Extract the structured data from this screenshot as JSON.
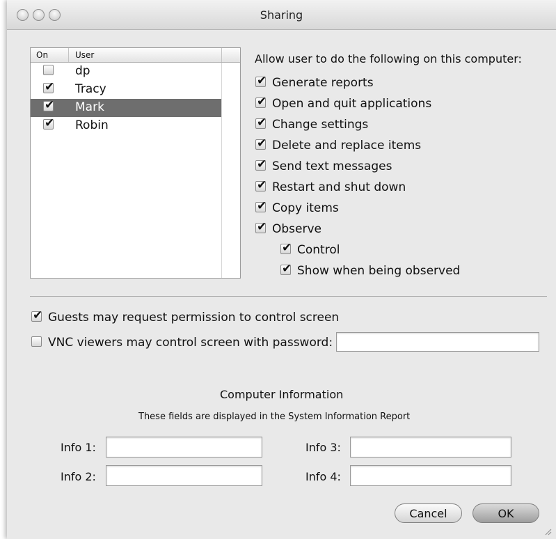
{
  "window": {
    "title": "Sharing"
  },
  "user_list": {
    "columns": {
      "on": "On",
      "user": "User"
    },
    "users": [
      {
        "name": "dp",
        "checked": false
      },
      {
        "name": "Tracy",
        "checked": true
      },
      {
        "name": "Mark",
        "checked": true,
        "selected": true
      },
      {
        "name": "Robin",
        "checked": true
      }
    ]
  },
  "permissions": {
    "heading": "Allow user to do the following on this computer:",
    "items": [
      {
        "label": "Generate reports",
        "checked": true
      },
      {
        "label": "Open and quit applications",
        "checked": true
      },
      {
        "label": "Change settings",
        "checked": true
      },
      {
        "label": "Delete and replace items",
        "checked": true
      },
      {
        "label": "Send text messages",
        "checked": true
      },
      {
        "label": "Restart and shut down",
        "checked": true
      },
      {
        "label": "Copy items",
        "checked": true
      },
      {
        "label": "Observe",
        "checked": true
      },
      {
        "label": "Control",
        "checked": true
      },
      {
        "label": "Show when being observed",
        "checked": true
      }
    ]
  },
  "options": {
    "guests": {
      "label": "Guests may request permission to control screen",
      "checked": true
    },
    "vnc": {
      "label": "VNC viewers may control screen with password:",
      "checked": false,
      "password_value": ""
    }
  },
  "computer_info": {
    "title": "Computer Information",
    "subtitle": "These fields are displayed in the System Information Report",
    "fields": [
      {
        "label": "Info 1:",
        "value": ""
      },
      {
        "label": "Info 2:",
        "value": ""
      },
      {
        "label": "Info 3:",
        "value": ""
      },
      {
        "label": "Info 4:",
        "value": ""
      }
    ]
  },
  "buttons": {
    "cancel": "Cancel",
    "ok": "OK"
  }
}
